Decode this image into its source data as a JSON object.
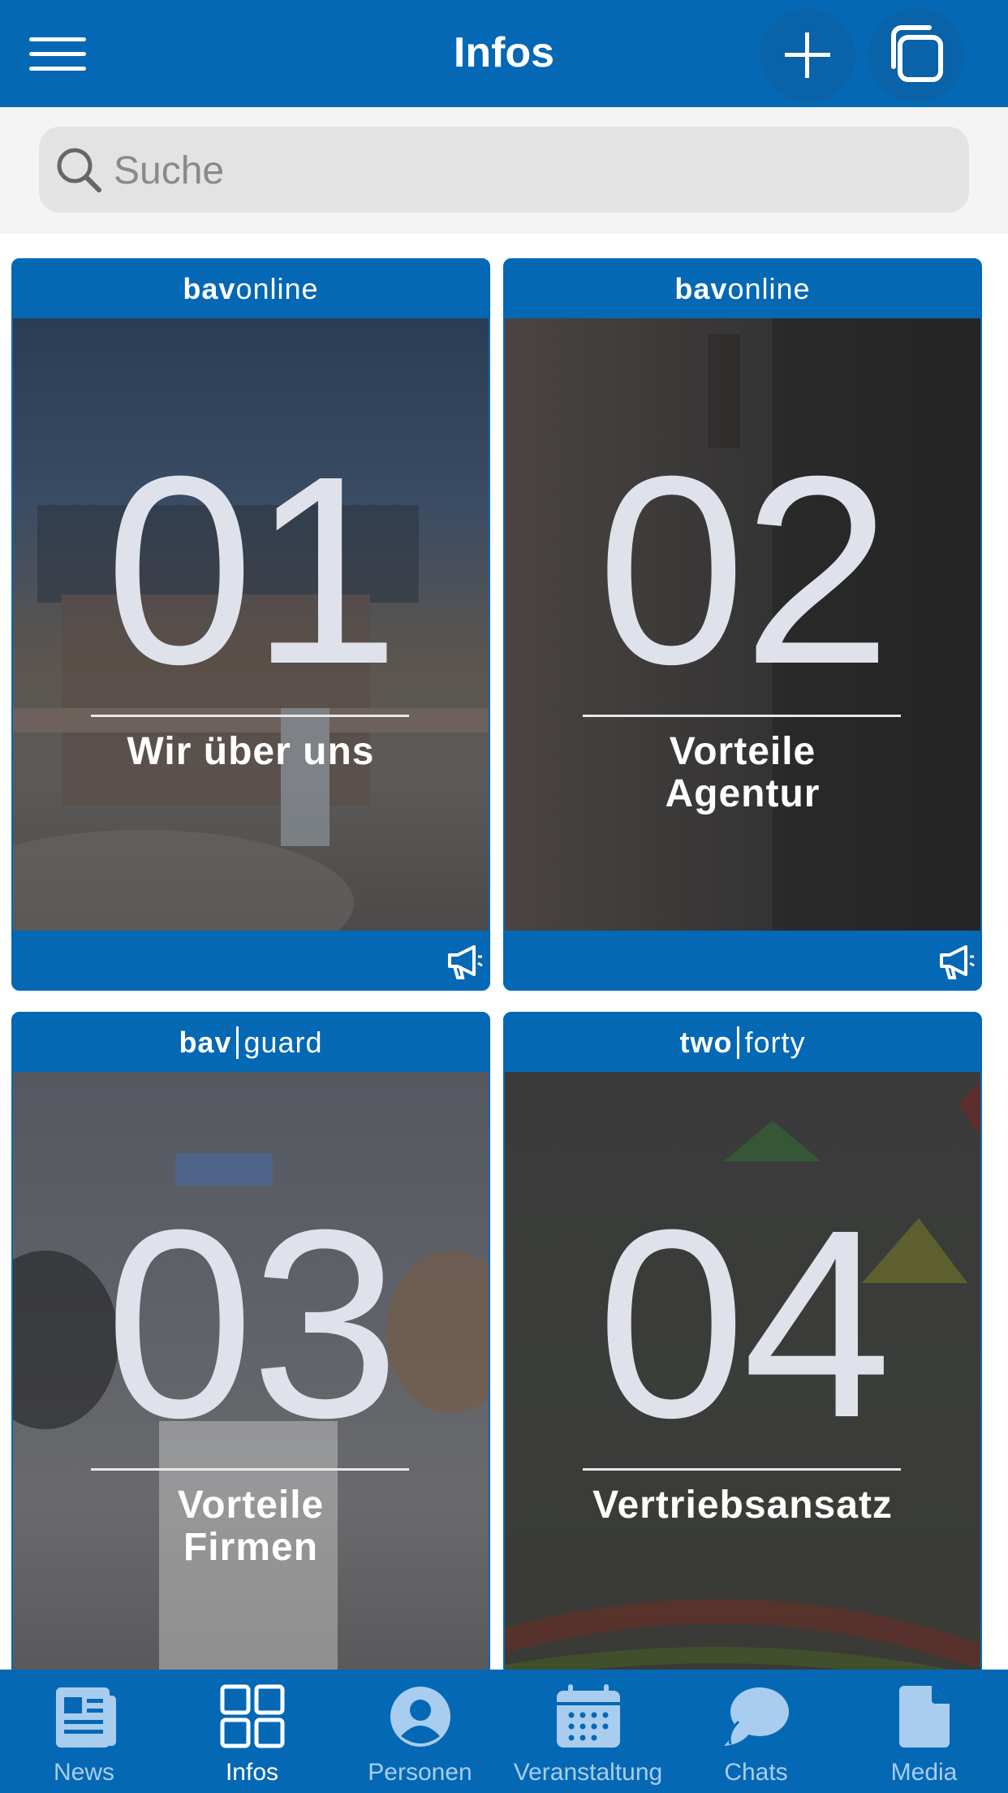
{
  "header": {
    "title": "Infos",
    "menu_icon": "hamburger-menu-icon",
    "add_icon": "plus-icon",
    "copy_icon": "copy-icon"
  },
  "search": {
    "placeholder": "Suche",
    "value": ""
  },
  "cards": [
    {
      "brand_bold": "bav",
      "brand_light": "online",
      "brand_sep": false,
      "number": "01",
      "label": "Wir über uns",
      "footer_icon": "megaphone-icon"
    },
    {
      "brand_bold": "bav",
      "brand_light": "online",
      "brand_sep": false,
      "number": "02",
      "label": "Vorteile\nAgentur",
      "footer_icon": "megaphone-icon"
    },
    {
      "brand_bold": "bav",
      "brand_light": "guard",
      "brand_sep": true,
      "number": "03",
      "label": "Vorteile\nFirmen"
    },
    {
      "brand_bold": "two",
      "brand_light": "forty",
      "brand_sep": true,
      "number": "04",
      "label": "Vertriebsansatz"
    }
  ],
  "tabs": [
    {
      "label": "News",
      "icon": "newspaper-icon",
      "active": false
    },
    {
      "label": "Infos",
      "icon": "grid-icon",
      "active": true
    },
    {
      "label": "Personen",
      "icon": "person-icon",
      "active": false
    },
    {
      "label": "Veranstaltung",
      "icon": "calendar-icon",
      "active": false
    },
    {
      "label": "Chats",
      "icon": "chat-icon",
      "active": false
    },
    {
      "label": "Media",
      "icon": "document-icon",
      "active": false
    }
  ],
  "colors": {
    "primary": "#0568b5",
    "tab_inactive": "#a9cdee",
    "number": "#dfe2ea"
  }
}
